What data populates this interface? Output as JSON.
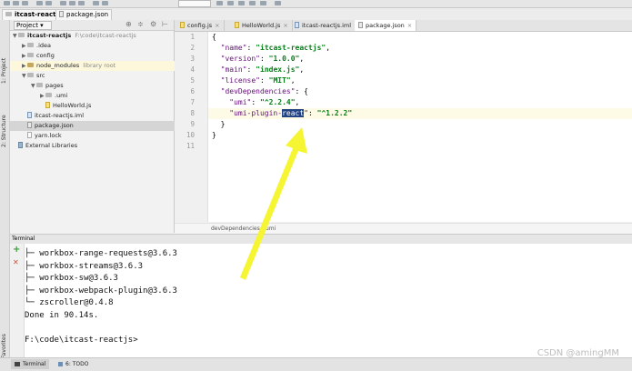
{
  "navbar": {
    "crumbs": [
      "itcast-reactjs",
      "package.json"
    ]
  },
  "left_strip": {
    "tabs": [
      "1: Project",
      "2: Structure",
      "2: Favorites"
    ]
  },
  "project": {
    "header_label": "Project",
    "tree": [
      {
        "label": "itcast-reactjs",
        "suffix": "F:\\code\\itcast-reactjs",
        "kind": "folder",
        "indent": 0,
        "arrow": "▼",
        "bold": true
      },
      {
        "label": ".idea",
        "kind": "folder",
        "indent": 1,
        "arrow": "▶"
      },
      {
        "label": "config",
        "kind": "folder",
        "indent": 1,
        "arrow": "▶"
      },
      {
        "label": "node_modules",
        "suffix": "library root",
        "kind": "pkg",
        "indent": 1,
        "arrow": "▶",
        "hl": true
      },
      {
        "label": "src",
        "kind": "folder",
        "indent": 1,
        "arrow": "▼"
      },
      {
        "label": "pages",
        "kind": "folder",
        "indent": 2,
        "arrow": "▼"
      },
      {
        "label": ".umi",
        "kind": "folder",
        "indent": 3,
        "arrow": "▶"
      },
      {
        "label": "HelloWorld.js",
        "kind": "js",
        "indent": 3,
        "arrow": ""
      },
      {
        "label": "itcast-reactjs.iml",
        "kind": "iml",
        "indent": 1,
        "arrow": ""
      },
      {
        "label": "package.json",
        "kind": "json",
        "indent": 1,
        "arrow": "",
        "sel": true
      },
      {
        "label": "yarn.lock",
        "kind": "lock",
        "indent": 1,
        "arrow": ""
      },
      {
        "label": "External Libraries",
        "kind": "lib",
        "indent": 0,
        "arrow": ""
      }
    ]
  },
  "tabs": [
    {
      "label": "config.js",
      "kind": "js"
    },
    {
      "label": "HelloWorld.js",
      "kind": "js"
    },
    {
      "label": "itcast-reactjs.iml",
      "kind": "iml"
    },
    {
      "label": "package.json",
      "kind": "json",
      "active": true
    }
  ],
  "editor": {
    "line_numbers": [
      "1",
      "2",
      "3",
      "4",
      "5",
      "6",
      "7",
      "8",
      "9",
      "10",
      "11"
    ],
    "lines": {
      "l1": "{",
      "l2_key": "\"name\"",
      "l2_val": "\"itcast-reactjs\"",
      "l3_key": "\"version\"",
      "l3_val": "\"1.0.0\"",
      "l4_key": "\"main\"",
      "l4_val": "\"index.js\"",
      "l5_key": "\"license\"",
      "l5_val": "\"MIT\"",
      "l6_key": "\"devDependencies\"",
      "l7_key": "\"umi\"",
      "l7_val": "\"^2.2.4\"",
      "l8_key_a": "\"umi-plugin-",
      "l8_key_sel": "react",
      "l8_key_b": "\"",
      "l8_val": "\"^1.2.2\"",
      "l9": "}",
      "l10": "}"
    },
    "breadcrumbs": "devDependencies  ›  umi"
  },
  "terminal": {
    "title": "Terminal",
    "lines": [
      "├─ workbox-range-requests@3.6.3",
      "├─ workbox-streams@3.6.3",
      "├─ workbox-sw@3.6.3",
      "├─ workbox-webpack-plugin@3.6.3",
      "└─ zscroller@0.4.8",
      "Done in 90.14s.",
      "",
      "F:\\code\\itcast-reactjs>"
    ],
    "add_symbol": "+",
    "close_symbol": "✕"
  },
  "bottombar": {
    "tabs": [
      "Terminal",
      "6: TODO"
    ]
  },
  "watermark": "CSDN @amingMM",
  "colors": {
    "annotation_arrow": "#f5f533",
    "selection": "#214283"
  }
}
